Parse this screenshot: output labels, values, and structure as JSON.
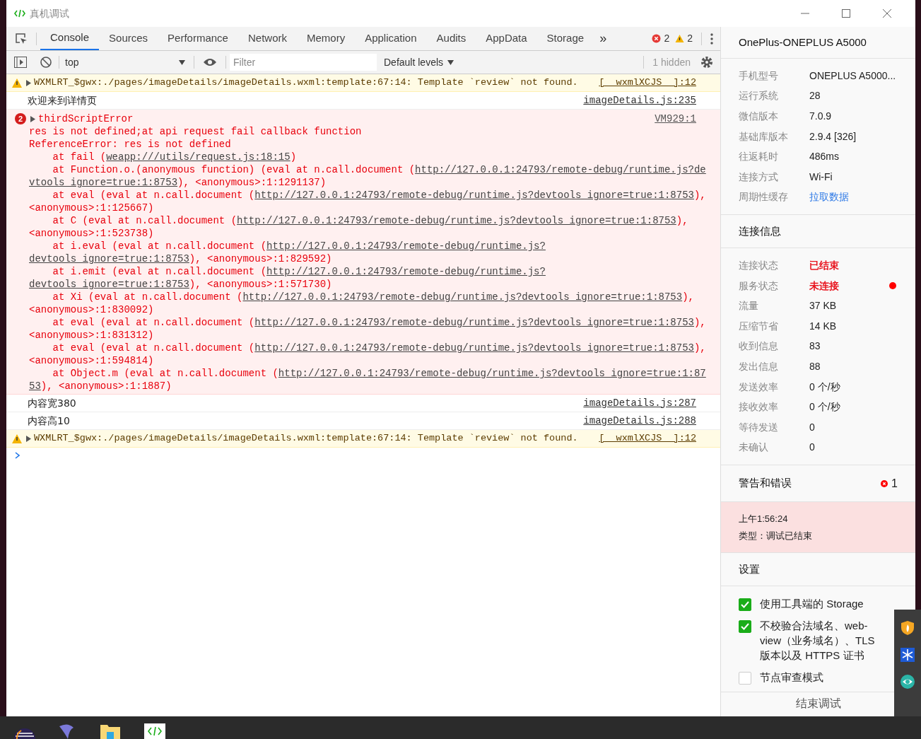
{
  "window": {
    "title": "真机调试"
  },
  "toolbar": {
    "tabs": [
      {
        "label": "Console",
        "selected": true
      },
      {
        "label": "Sources",
        "selected": false
      },
      {
        "label": "Performance",
        "selected": false
      },
      {
        "label": "Network",
        "selected": false
      },
      {
        "label": "Memory",
        "selected": false
      },
      {
        "label": "Application",
        "selected": false
      },
      {
        "label": "Audits",
        "selected": false
      },
      {
        "label": "AppData",
        "selected": false
      },
      {
        "label": "Storage",
        "selected": false
      }
    ],
    "more": "»",
    "error_count": "2",
    "warning_count": "2"
  },
  "filter_bar": {
    "context": "top",
    "filter": {
      "placeholder": "Filter"
    },
    "levels": "Default levels",
    "hidden": "1 hidden"
  },
  "console": [
    {
      "kind": "warning",
      "text": "WXMLRT_$gwx:./pages/imageDetails/imageDetails.wxml:template:67:14: Template `review` not found.",
      "source": "[__wxmlXCJS__]:12"
    },
    {
      "kind": "log",
      "text": "欢迎来到详情页",
      "source": "imageDetails.js:235"
    },
    {
      "kind": "error",
      "count": "2",
      "text": "thirdScriptError",
      "source": "VM929:1",
      "lines": [
        [
          {
            "text": "res is not defined;at api request fail callback function",
            "link": false
          }
        ],
        [
          {
            "text": "ReferenceError: res is not defined",
            "link": false
          }
        ],
        [
          {
            "text": "    at fail (",
            "link": false
          },
          {
            "text": "weapp:///utils/request.js:18:15",
            "link": true
          },
          {
            "text": ")",
            "link": false
          }
        ],
        [
          {
            "text": "    at Function.o.(anonymous function) (eval at n.call.document (",
            "link": false
          },
          {
            "text": "http://127.0.0.1:24793/remote-debug/runtime.js?de",
            "link": true
          }
        ],
        [
          {
            "text": "vtools_ignore=true:1:8753",
            "link": true
          },
          {
            "text": "), <anonymous>:1:1291137)",
            "link": false
          }
        ],
        [
          {
            "text": "    at eval (eval at n.call.document (",
            "link": false
          },
          {
            "text": "http://127.0.0.1:24793/remote-debug/runtime.js?devtools_ignore=true:1:8753",
            "link": true
          },
          {
            "text": "),",
            "link": false
          }
        ],
        [
          {
            "text": "<anonymous>:1:125667)",
            "link": false
          }
        ],
        [
          {
            "text": "    at C (eval at n.call.document (",
            "link": false
          },
          {
            "text": "http://127.0.0.1:24793/remote-debug/runtime.js?devtools_ignore=true:1:8753",
            "link": true
          },
          {
            "text": "),",
            "link": false
          }
        ],
        [
          {
            "text": "<anonymous>:1:523738)",
            "link": false
          }
        ],
        [
          {
            "text": "    at i.eval (eval at n.call.document (",
            "link": false
          },
          {
            "text": "http://127.0.0.1:24793/remote-debug/runtime.js?",
            "link": true
          }
        ],
        [
          {
            "text": "devtools_ignore=true:1:8753",
            "link": true
          },
          {
            "text": "), <anonymous>:1:829592)",
            "link": false
          }
        ],
        [
          {
            "text": "    at i.emit (eval at n.call.document (",
            "link": false
          },
          {
            "text": "http://127.0.0.1:24793/remote-debug/runtime.js?",
            "link": true
          }
        ],
        [
          {
            "text": "devtools_ignore=true:1:8753",
            "link": true
          },
          {
            "text": "), <anonymous>:1:571730)",
            "link": false
          }
        ],
        [
          {
            "text": "    at Xi (eval at n.call.document (",
            "link": false
          },
          {
            "text": "http://127.0.0.1:24793/remote-debug/runtime.js?devtools_ignore=true:1:8753",
            "link": true
          },
          {
            "text": "),",
            "link": false
          }
        ],
        [
          {
            "text": "<anonymous>:1:830092)",
            "link": false
          }
        ],
        [
          {
            "text": "    at eval (eval at n.call.document (",
            "link": false
          },
          {
            "text": "http://127.0.0.1:24793/remote-debug/runtime.js?devtools_ignore=true:1:8753",
            "link": true
          },
          {
            "text": "),",
            "link": false
          }
        ],
        [
          {
            "text": "<anonymous>:1:831312)",
            "link": false
          }
        ],
        [
          {
            "text": "    at eval (eval at n.call.document (",
            "link": false
          },
          {
            "text": "http://127.0.0.1:24793/remote-debug/runtime.js?devtools_ignore=true:1:8753",
            "link": true
          },
          {
            "text": "),",
            "link": false
          }
        ],
        [
          {
            "text": "<anonymous>:1:594814)",
            "link": false
          }
        ],
        [
          {
            "text": "    at Object.m (eval at n.call.document (",
            "link": false
          },
          {
            "text": "http://127.0.0.1:24793/remote-debug/runtime.js?devtools_ignore=true:1:87",
            "link": true
          }
        ],
        [
          {
            "text": "53",
            "link": true
          },
          {
            "text": "), <anonymous>:1:1887)",
            "link": false
          }
        ]
      ]
    },
    {
      "kind": "log",
      "text": "内容宽380",
      "source": "imageDetails.js:287"
    },
    {
      "kind": "log",
      "text": "内容高10",
      "source": "imageDetails.js:288"
    },
    {
      "kind": "warning",
      "text": "WXMLRT_$gwx:./pages/imageDetails/imageDetails.wxml:template:67:14: Template `review` not found.",
      "source": "[__wxmlXCJS__]:12"
    }
  ],
  "panel": {
    "device": "OnePlus-ONEPLUS A5000",
    "device_info": [
      {
        "label": "手机型号",
        "value": "ONEPLUS A5000...",
        "kind": "text"
      },
      {
        "label": "运行系统",
        "value": "28",
        "kind": "text"
      },
      {
        "label": "微信版本",
        "value": "7.0.9",
        "kind": "text"
      },
      {
        "label": "基础库版本",
        "value": "2.9.4 [326]",
        "kind": "text"
      },
      {
        "label": "往返耗时",
        "value": "486ms",
        "kind": "text"
      },
      {
        "label": "连接方式",
        "value": "Wi-Fi",
        "kind": "text"
      },
      {
        "label": "周期性缓存",
        "value": "拉取数据",
        "kind": "link"
      }
    ],
    "connection_title": "连接信息",
    "connection": [
      {
        "label": "连接状态",
        "value": "已结束",
        "kind": "danger",
        "dot": false
      },
      {
        "label": "服务状态",
        "value": "未连接",
        "kind": "danger",
        "dot": true
      },
      {
        "label": "流量",
        "value": "37 KB",
        "kind": "text",
        "dot": false
      },
      {
        "label": "压缩节省",
        "value": "14 KB",
        "kind": "text",
        "dot": false
      },
      {
        "label": "收到信息",
        "value": "83",
        "kind": "text",
        "dot": false
      },
      {
        "label": "发出信息",
        "value": "88",
        "kind": "text",
        "dot": false
      },
      {
        "label": "发送效率",
        "value": "0 个/秒",
        "kind": "text",
        "dot": false
      },
      {
        "label": "接收效率",
        "value": "0 个/秒",
        "kind": "text",
        "dot": false
      },
      {
        "label": "等待发送",
        "value": "0",
        "kind": "text",
        "dot": false
      },
      {
        "label": "未确认",
        "value": "0",
        "kind": "text",
        "dot": false
      }
    ],
    "alerts_title": "警告和错误",
    "alerts_count": "1",
    "alert": {
      "time": "上午1:56:24",
      "type": "类型：调试已结束"
    },
    "settings_title": "设置",
    "settings": [
      {
        "label": "使用工具端的 Storage",
        "checked": true
      },
      {
        "label": "不校验合法域名、web-view（业务域名）、TLS 版本以及 HTTPS 证书",
        "checked": true
      },
      {
        "label": "节点审查模式",
        "checked": false
      }
    ],
    "end_button": "结束调试"
  }
}
